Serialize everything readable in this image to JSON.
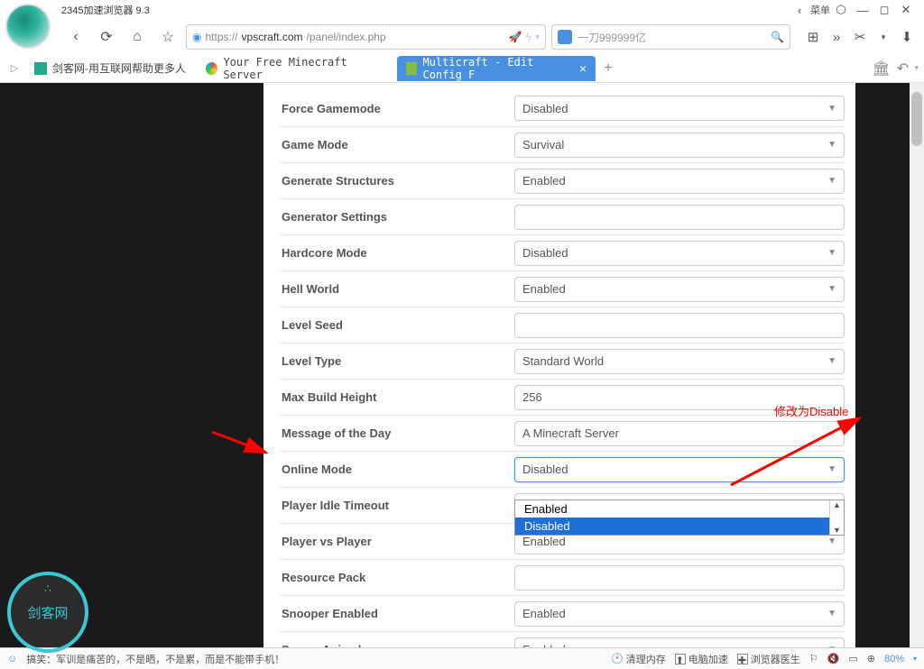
{
  "browser": {
    "title": "2345加速浏览器 9.3",
    "menu": "菜单",
    "url_proto": "https://",
    "url_domain": "vpscraft.com",
    "url_path": "/panel/index.php",
    "search_placeholder": "一刀999999亿"
  },
  "tabs": [
    {
      "label": "剑客网-用互联网帮助更多人",
      "active": false
    },
    {
      "label": "Your Free Minecraft Server",
      "active": false
    },
    {
      "label": "Multicraft - Edit Config F",
      "active": true
    }
  ],
  "form": {
    "rows": [
      {
        "label": "Force Gamemode",
        "type": "select",
        "value": "Disabled"
      },
      {
        "label": "Game Mode",
        "type": "select",
        "value": "Survival"
      },
      {
        "label": "Generate Structures",
        "type": "select",
        "value": "Enabled"
      },
      {
        "label": "Generator Settings",
        "type": "input",
        "value": ""
      },
      {
        "label": "Hardcore Mode",
        "type": "select",
        "value": "Disabled"
      },
      {
        "label": "Hell World",
        "type": "select",
        "value": "Enabled"
      },
      {
        "label": "Level Seed",
        "type": "input",
        "value": ""
      },
      {
        "label": "Level Type",
        "type": "select",
        "value": "Standard World"
      },
      {
        "label": "Max Build Height",
        "type": "input",
        "value": "256"
      },
      {
        "label": "Message of the Day",
        "type": "input",
        "value": "A Minecraft Server"
      },
      {
        "label": "Online Mode",
        "type": "select",
        "value": "Disabled",
        "open": true
      },
      {
        "label": "Player Idle Timeout",
        "type": "input",
        "value": ""
      },
      {
        "label": "Player vs Player",
        "type": "select",
        "value": "Enabled"
      },
      {
        "label": "Resource Pack",
        "type": "input",
        "value": ""
      },
      {
        "label": "Snooper Enabled",
        "type": "select",
        "value": "Enabled"
      },
      {
        "label": "Spawn Animals",
        "type": "select",
        "value": "Enabled"
      }
    ],
    "dropdown_options": [
      "Enabled",
      "Disabled"
    ]
  },
  "annotation": "修改为Disable",
  "statusbar": {
    "joke": "搞笑：军训是痛苦的，不是晒，不是累，而是不能带手机！",
    "items": [
      "清理内存",
      "电脑加速",
      "浏览器医生"
    ],
    "zoom": "80%"
  },
  "watermark": "剑客网"
}
